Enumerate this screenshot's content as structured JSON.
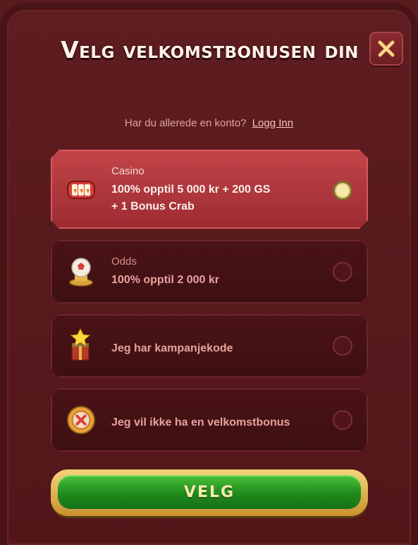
{
  "modal": {
    "title": "Velg velkomstbonusen din",
    "close_icon": "close-icon"
  },
  "login": {
    "prompt": "Har du allerede en konto?",
    "link": "Logg Inn"
  },
  "options": [
    {
      "label": "Casino",
      "main_line1": "100% opptil 5 000 kr + 200 GS",
      "main_line2": "+ 1 Bonus Crab",
      "icon": "slot-machine-icon",
      "selected": true
    },
    {
      "label": "Odds",
      "main_line1": "100% opptil 2 000 kr",
      "icon": "football-trophy-icon",
      "selected": false
    },
    {
      "main_line1": "Jeg har kampanjekode",
      "icon": "star-gift-box-icon",
      "selected": false
    },
    {
      "main_line1": "Jeg vil ikke ha en velkomstbonus",
      "icon": "no-bonus-chip-icon",
      "selected": false
    }
  ],
  "submit": {
    "label": "VELG"
  },
  "colors": {
    "selected_bg": "#c24448",
    "button_green": "#1f8a1a",
    "accent_gold": "#f5d37a"
  }
}
